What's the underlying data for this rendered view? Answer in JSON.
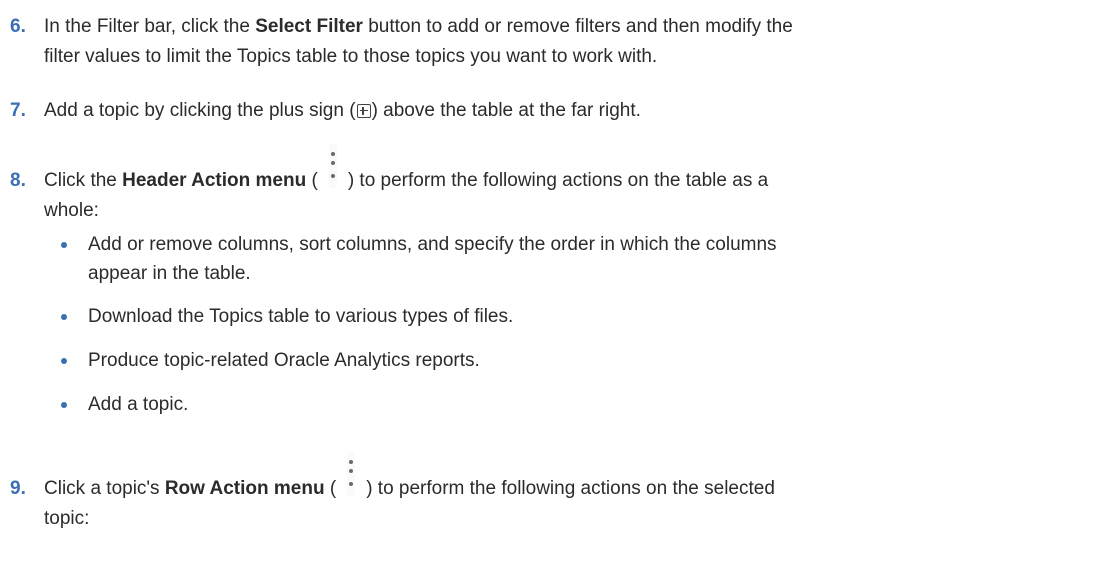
{
  "step6": {
    "number": "6.",
    "pre": "In the Filter bar, click the ",
    "bold": "Select Filter",
    "post": " button to add or remove filters and then modify the",
    "line2": "filter values to limit the Topics table to those topics you want to work with."
  },
  "step7": {
    "number": "7.",
    "pre": "Add a topic by clicking the plus sign (",
    "post": ") above the table at the far right.",
    "icon": "plus-box-icon"
  },
  "step8": {
    "number": "8.",
    "pre": "Click the ",
    "bold": "Header Action menu",
    "mid": " (",
    "post": ") to perform the following actions on the table as a",
    "line2": "whole:",
    "icon": "kebab-menu-icon",
    "bullets": [
      {
        "l1": "Add or remove columns, sort columns, and specify the order in which the columns",
        "l2": "appear in the table."
      },
      {
        "l1": "Download the Topics table to various types of files.",
        "l2": ""
      },
      {
        "l1": "Produce topic-related Oracle Analytics reports.",
        "l2": ""
      },
      {
        "l1": "Add a topic.",
        "l2": ""
      }
    ]
  },
  "step9": {
    "number": "9.",
    "pre": "Click a topic's ",
    "bold": "Row Action menu",
    "mid": " (",
    "post": ") to perform the following actions on the selected",
    "line2": "topic:",
    "icon": "kebab-menu-icon"
  },
  "colors": {
    "number": "#3a6fb5",
    "bullet": "#3a6fb5",
    "text": "#2b2b2b"
  }
}
